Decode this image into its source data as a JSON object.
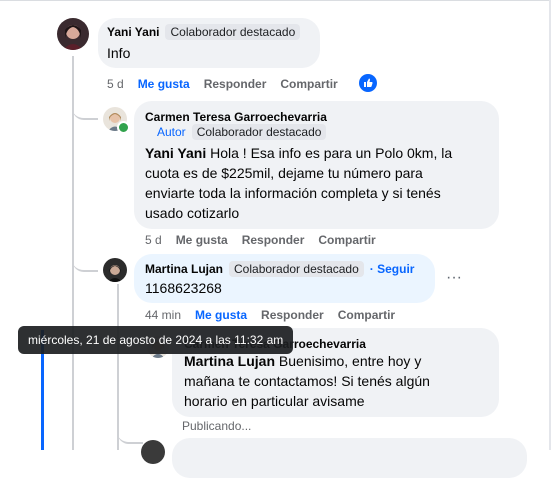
{
  "comments": [
    {
      "author": "Yani Yani",
      "badges": [
        "Colaborador destacado"
      ],
      "text": "Info",
      "time": "5 d",
      "like": "Me gusta",
      "reply": "Responder",
      "share": "Compartir"
    },
    {
      "author": "Carmen Teresa Garroechevarria",
      "role": "Autor",
      "badges": [
        "Colaborador destacado"
      ],
      "mention": "Yani Yani",
      "text_lines": [
        "Hola ! Esa info es para un Polo 0km, la",
        "cuota es de $225mil, dejame tu número para",
        "enviarte toda la información completa y si tenés",
        "usado cotizarlo"
      ],
      "time": "5 d",
      "like": "Me gusta",
      "reply": "Responder",
      "share": "Compartir"
    },
    {
      "author": "Martina Lujan",
      "badges": [
        "Colaborador destacado"
      ],
      "follow": "· Seguir",
      "text": "1168623268",
      "time": "44 min",
      "like": "Me gusta",
      "reply": "Responder",
      "share": "Compartir"
    },
    {
      "author": "Carmen Teresa Garroechevarria",
      "mention": "Martina Lujan",
      "text_lines": [
        "Buenisimo, entre hoy y",
        "mañana te contactamos! Si tenés algún",
        "horario en particular avisame"
      ],
      "status": "Publicando..."
    }
  ],
  "tooltip": "miércoles, 21 de agosto de 2024 a las 11:32 am",
  "colors": {
    "accent": "#0866ff",
    "bubble": "#f0f2f5",
    "highlight": "#ebf5ff",
    "online": "#31a24c"
  },
  "icons": {
    "like_reaction": "like-reaction-icon",
    "more": "more-options-icon"
  }
}
